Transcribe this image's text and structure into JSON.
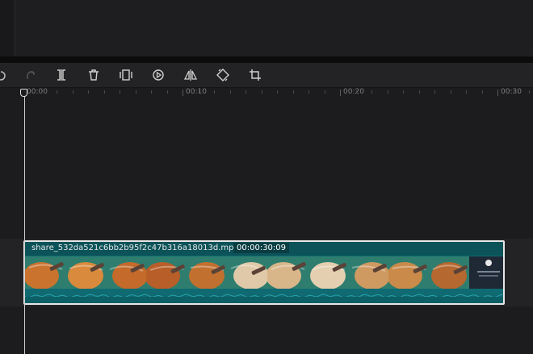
{
  "toolbar": {
    "tools": [
      {
        "name": "undo-icon",
        "label": "Undo"
      },
      {
        "name": "redo-icon",
        "label": "Redo"
      },
      {
        "name": "split-icon",
        "label": "Split"
      },
      {
        "name": "delete-icon",
        "label": "Delete"
      },
      {
        "name": "freeze-frame-icon",
        "label": "Freeze frame"
      },
      {
        "name": "play-speed-icon",
        "label": "Speed"
      },
      {
        "name": "mirror-icon",
        "label": "Mirror"
      },
      {
        "name": "rotate-icon",
        "label": "Rotate"
      },
      {
        "name": "crop-icon",
        "label": "Crop"
      }
    ]
  },
  "ruler": {
    "labels": [
      "00:00",
      "00:10",
      "00:20",
      "00:30"
    ]
  },
  "clip": {
    "name": "share_532da521c6bb2b95f2c47b316a18013d.mp4",
    "duration": "00:00:30:09"
  },
  "colors": {
    "clip_body": "#0f6a72",
    "clip_header": "#0b5359",
    "playhead": "#cfcfcf"
  }
}
